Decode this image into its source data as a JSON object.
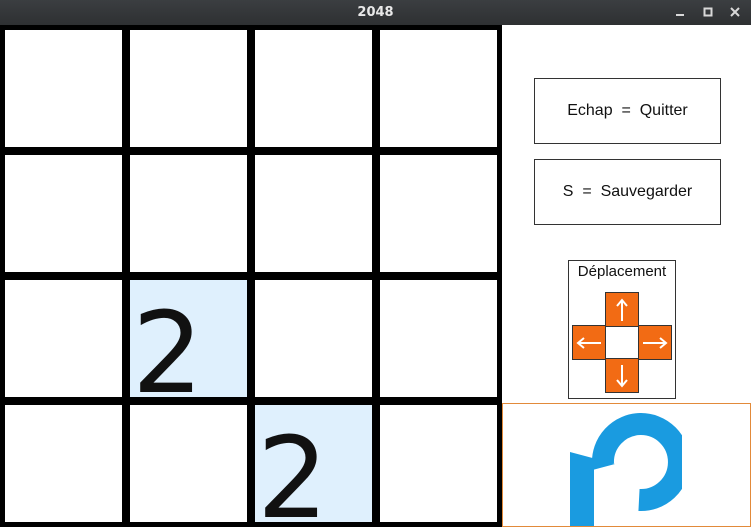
{
  "window": {
    "title": "2048",
    "controls": [
      "minimize-icon",
      "maximize-icon",
      "close-icon"
    ]
  },
  "board": {
    "rows": [
      [
        "",
        "",
        "",
        ""
      ],
      [
        "",
        "",
        "",
        ""
      ],
      [
        "",
        "2",
        "",
        ""
      ],
      [
        "",
        "",
        "2",
        ""
      ]
    ],
    "colors": {
      "grid": "#000000",
      "empty": "#ffffff",
      "tile_2": "#dff0fd"
    }
  },
  "controls": {
    "quit_label": "Echap  =  Quitter",
    "save_label": "S  =  Sauvegarder",
    "move_label": "Déplacement",
    "arrow_icons": [
      "arrow-up-icon",
      "arrow-left-icon",
      "arrow-right-icon",
      "arrow-down-icon"
    ],
    "arrow_color": "#f26b14",
    "restart_icon": "restart-icon",
    "restart_color": "#1a9be0"
  }
}
